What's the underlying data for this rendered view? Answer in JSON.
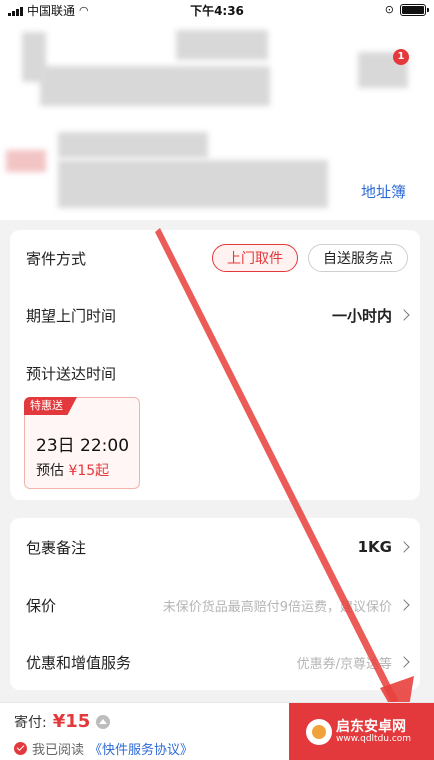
{
  "status_bar": {
    "carrier": "中国联通",
    "time": "下午4:36"
  },
  "header": {
    "notification_count": "1",
    "address_book_link": "地址簿"
  },
  "shipping": {
    "method_label": "寄件方式",
    "method_options": [
      "上门取件",
      "自送服务点"
    ],
    "method_selected": "上门取件",
    "pickup_time_label": "期望上门时间",
    "pickup_time_value": "一小时内",
    "eta_label": "预计送达时间",
    "eta_card": {
      "tag": "特惠送",
      "datetime": "23日 22:00",
      "estimate_prefix": "预估",
      "estimate_price": "¥15起"
    }
  },
  "package": {
    "note_label": "包裹备注",
    "note_value": "1KG",
    "insurance_label": "保价",
    "insurance_hint": "未保价货品最高赔付9倍运费，建议保价",
    "services_label": "优惠和增值服务",
    "services_hint": "优惠券/京尊达等"
  },
  "footer": {
    "pay_label": "寄付:",
    "pay_amount": "¥15",
    "agree_text": "我已阅读",
    "agreement_link": "《快件服务协议》"
  },
  "watermark": {
    "name": "启东安卓网",
    "url": "www.qdltdu.com"
  },
  "colors": {
    "accent": "#e4393c",
    "link": "#2f6bd8",
    "annotation_arrow": "#e8403c"
  }
}
